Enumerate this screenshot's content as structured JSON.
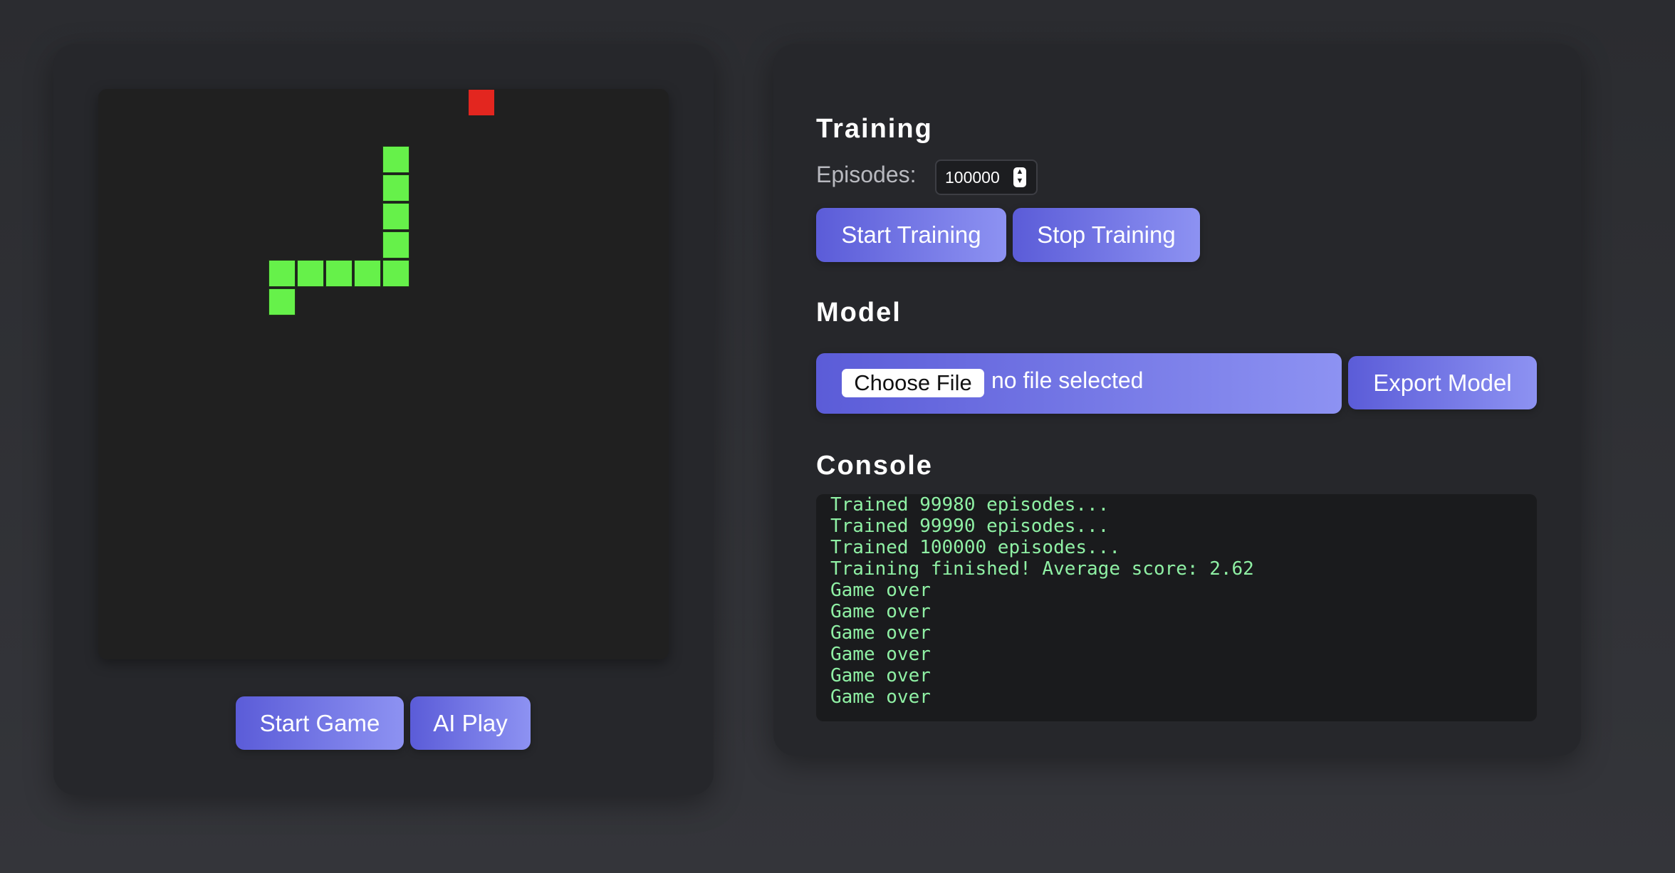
{
  "game": {
    "start_label": "Start Game",
    "ai_label": "AI Play",
    "snake_color": "#66f14a",
    "food_color": "#e3261f"
  },
  "training": {
    "title": "Training",
    "episodes_label": "Episodes:",
    "episodes_value": "100000",
    "start_label": "Start Training",
    "stop_label": "Stop Training"
  },
  "model": {
    "title": "Model",
    "choose_file_label": "Choose File",
    "file_status": "no file selected",
    "export_label": "Export Model"
  },
  "console": {
    "title": "Console",
    "lines": [
      "Trained 99980 episodes...",
      "Trained 99990 episodes...",
      "Trained 100000 episodes...",
      "Training finished! Average score: 2.62",
      "Game over",
      "Game over",
      "Game over",
      "Game over",
      "Game over",
      "Game over"
    ]
  }
}
